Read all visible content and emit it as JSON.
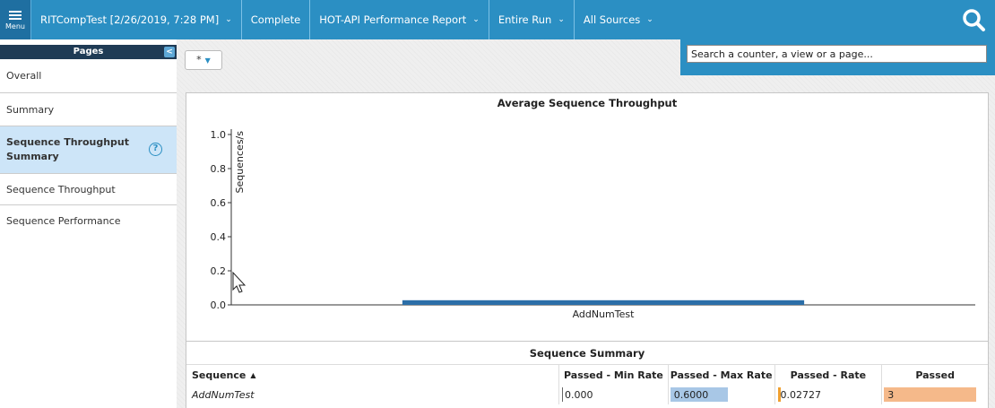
{
  "topbar": {
    "menu_label": "Menu",
    "breadcrumbs": [
      "RITCompTest [2/26/2019, 7:28 PM]",
      "Complete",
      "HOT-API Performance Report",
      "Entire Run",
      "All Sources"
    ],
    "accent_color": "#2b8fc3",
    "icons": [
      "menu-icon",
      "chevron-down-icon",
      "search-icon"
    ]
  },
  "sidebar": {
    "header": "Pages",
    "collapse_glyph": "<",
    "items": [
      {
        "label": "Overall"
      },
      {
        "label": "Summary"
      },
      {
        "label": "Sequence Throughput Summary",
        "line1": "Sequence Throughput",
        "line2": "Summary",
        "active": true
      },
      {
        "label": "Sequence Throughput"
      },
      {
        "label": "Sequence Performance"
      }
    ],
    "help_glyph": "?"
  },
  "toolbar": {
    "filter_label": "*"
  },
  "search": {
    "value": "Search a counter, a view or a page..."
  },
  "chart_data": {
    "type": "bar",
    "title": "Average Sequence Throughput",
    "xlabel": "",
    "ylabel": "Sequences/s",
    "categories": [
      "AddNumTest"
    ],
    "values": [
      0.02727
    ],
    "ylim": [
      0,
      1.0
    ],
    "yticks": [
      "0.0",
      "0.2",
      "0.4",
      "0.6",
      "0.8",
      "1.0"
    ],
    "bar_color": "#2b6ea8",
    "grid": false,
    "legend": "none"
  },
  "table": {
    "title": "Sequence Summary",
    "columns": [
      "Sequence",
      "Passed - Min Rate",
      "Passed - Max Rate",
      "Passed - Rate",
      "Passed"
    ],
    "sort_glyph": "▲",
    "rows": [
      {
        "sequence": "AddNumTest",
        "min_rate": "0.000",
        "max_rate": "0.6000",
        "rate": "0.02727",
        "passed": "3"
      }
    ],
    "colors": {
      "max_rate_bar": "#a8c7e6",
      "rate_bar": "#f0a030",
      "passed_bar": "#f5b98a",
      "min_rate_bar": "#666666"
    }
  }
}
